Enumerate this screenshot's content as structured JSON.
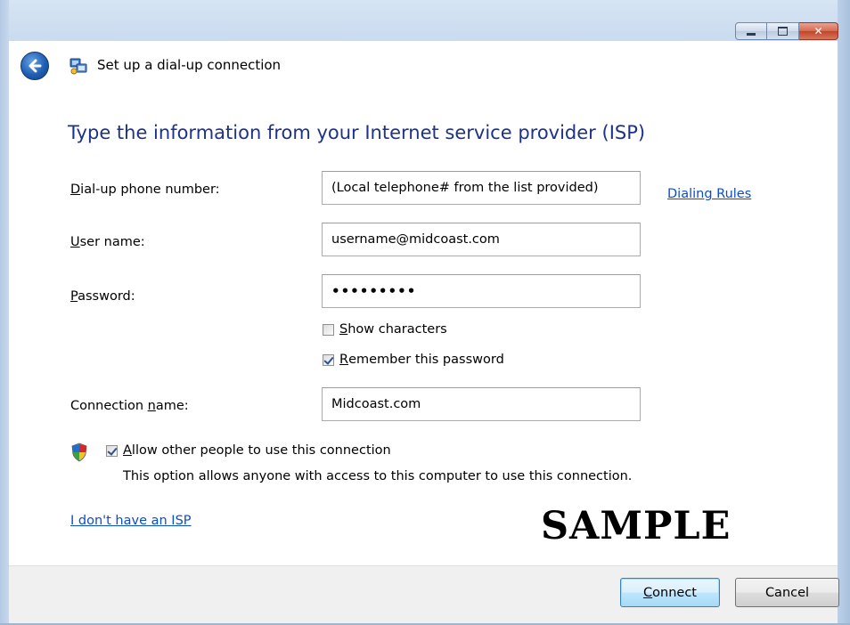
{
  "window": {
    "title": "Set up a dial-up connection",
    "caption_buttons": [
      "minimize",
      "maximize",
      "close"
    ]
  },
  "main": {
    "heading": "Type the information from your Internet service provider (ISP)",
    "fields": {
      "phone": {
        "label_pre": "",
        "label_accel": "D",
        "label_post": "ial-up phone number:",
        "value": "(Local telephone# from the list provided)"
      },
      "username": {
        "label_pre": "",
        "label_accel": "U",
        "label_post": "ser name:",
        "value": "username@midcoast.com"
      },
      "password": {
        "label_pre": "",
        "label_accel": "P",
        "label_post": "assword:",
        "value": "•••••••••"
      },
      "connection": {
        "label_pre": "Connection ",
        "label_accel": "n",
        "label_post": "ame:",
        "value": "Midcoast.com"
      }
    },
    "dialing_rules_link": "Dialing Rules",
    "show_characters": {
      "accel": "S",
      "rest": "how characters",
      "checked": false
    },
    "remember_password": {
      "accel": "R",
      "rest": "emember this password",
      "checked": true
    },
    "allow_others": {
      "accel": "A",
      "rest": "llow other people to use this connection",
      "checked": true
    },
    "allow_note": "This option allows anyone with access to this computer to use this connection.",
    "no_isp_link": "I don't have an ISP",
    "watermark": "SAMPLE"
  },
  "footer": {
    "connect": {
      "accel": "C",
      "rest": "onnect"
    },
    "cancel": "Cancel"
  },
  "colors": {
    "heading": "#1e3287",
    "link": "#0a4ec8",
    "glass": "#c9dbef"
  },
  "icons": {
    "back": "back-arrow-icon",
    "title": "network-connection-icon",
    "shield": "uac-shield-icon"
  }
}
